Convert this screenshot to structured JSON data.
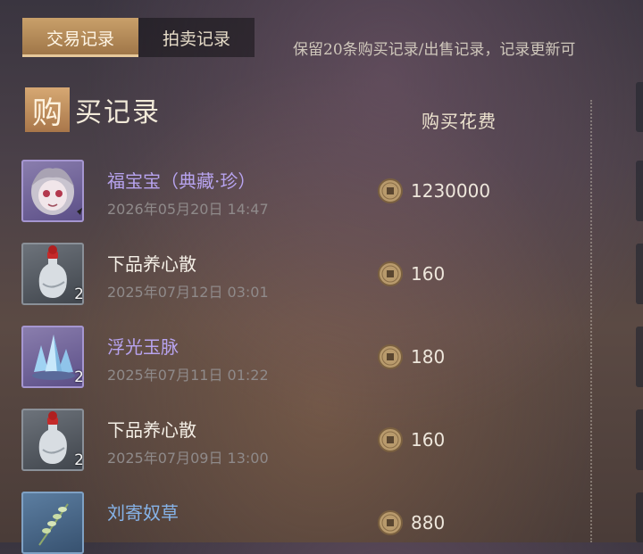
{
  "tabs": [
    {
      "label": "交易记录",
      "active": true
    },
    {
      "label": "拍卖记录",
      "active": false
    }
  ],
  "notice": "保留20条购买记录/出售记录，记录更新可",
  "section": {
    "title_first": "购",
    "title_rest": "买记录"
  },
  "column_header": "购买花费",
  "records": [
    {
      "name": "福宝宝（典藏·珍）",
      "time": "2026年05月20日 14:47",
      "price": "1230000",
      "quantity": "",
      "rarity": "purple",
      "icon": "doll-portrait-icon"
    },
    {
      "name": "下品养心散",
      "time": "2025年07月12日 03:01",
      "price": "160",
      "quantity": "2",
      "rarity": "white",
      "icon": "medicine-bottle-icon"
    },
    {
      "name": "浮光玉脉",
      "time": "2025年07月11日 01:22",
      "price": "180",
      "quantity": "2",
      "rarity": "purple",
      "icon": "crystal-ore-icon"
    },
    {
      "name": "下品养心散",
      "time": "2025年07月09日 13:00",
      "price": "160",
      "quantity": "2",
      "rarity": "white",
      "icon": "medicine-bottle-icon"
    },
    {
      "name": "刘寄奴草",
      "time": "",
      "price": "880",
      "quantity": "",
      "rarity": "blue",
      "icon": "herb-icon"
    }
  ],
  "currency_icon": "copper-coin-icon",
  "colors": {
    "accent": "#c9a06a",
    "purple_rarity": "#b7a3ee",
    "blue_rarity": "#86b3e8"
  }
}
